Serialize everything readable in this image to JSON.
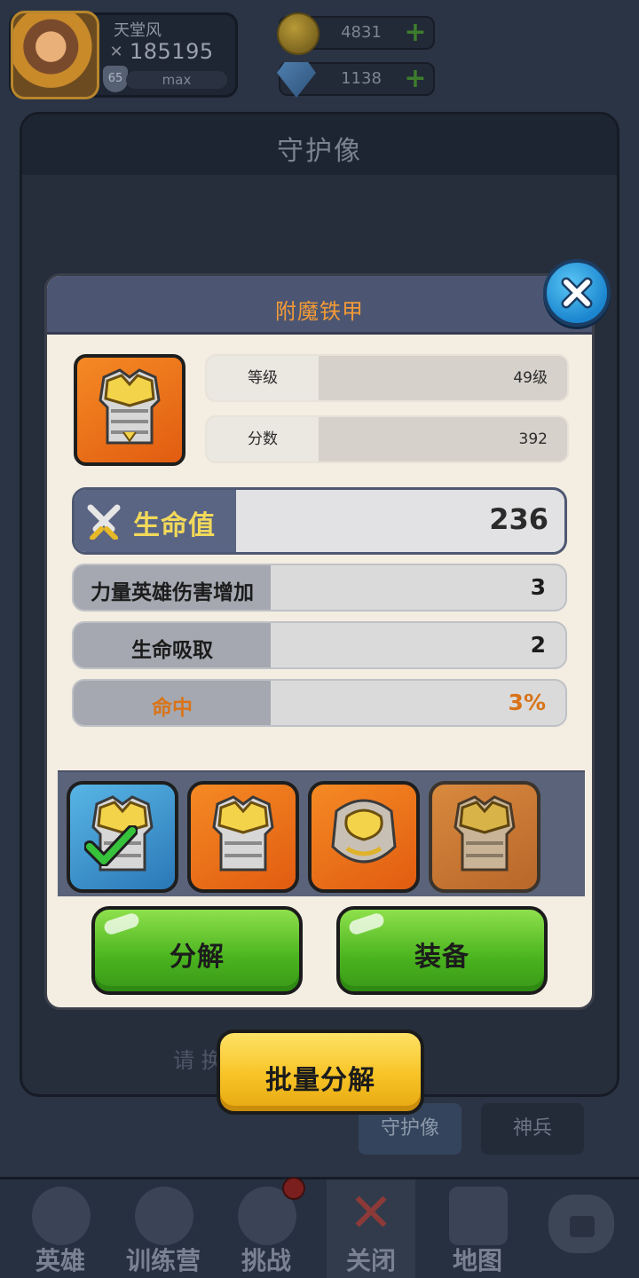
{
  "player": {
    "name": "天堂风",
    "power": "185195",
    "level": "65",
    "exp_label": "max"
  },
  "resources": {
    "gold": "4831",
    "gems": "1138",
    "plus_symbol": "+"
  },
  "background_panel": {
    "title": "守护像",
    "footer_text": "请                                      换",
    "tabs": [
      "守护像",
      "神兵"
    ]
  },
  "bottom_nav": {
    "items": [
      "英雄",
      "训练营",
      "挑战",
      "关闭",
      "地图"
    ]
  },
  "dialog": {
    "title": "附魔铁甲",
    "level_label": "等级",
    "level_value": "49级",
    "score_label": "分数",
    "score_value": "392",
    "main_stat": {
      "label": "生命值",
      "value": "236"
    },
    "sub_stats": [
      {
        "label": "力量英雄伤害增加",
        "value": "3"
      },
      {
        "label": "生命吸取",
        "value": "2"
      },
      {
        "label": "命中",
        "value": "3%"
      }
    ],
    "decompose_label": "分解",
    "equip_label": "装备"
  },
  "batch_decompose_label": "批量分解",
  "colors": {
    "dialog_title": "#f39a37",
    "main_stat_label": "#f2d95a",
    "hit_stat": "#d9741a",
    "green_button": "#49b31e",
    "yellow_button": "#f7c325",
    "close_button": "#1b86cf"
  },
  "icons": {
    "close": "close-icon",
    "sword": "sword-icon",
    "check": "checkmark-icon",
    "lock": "lock-icon"
  }
}
